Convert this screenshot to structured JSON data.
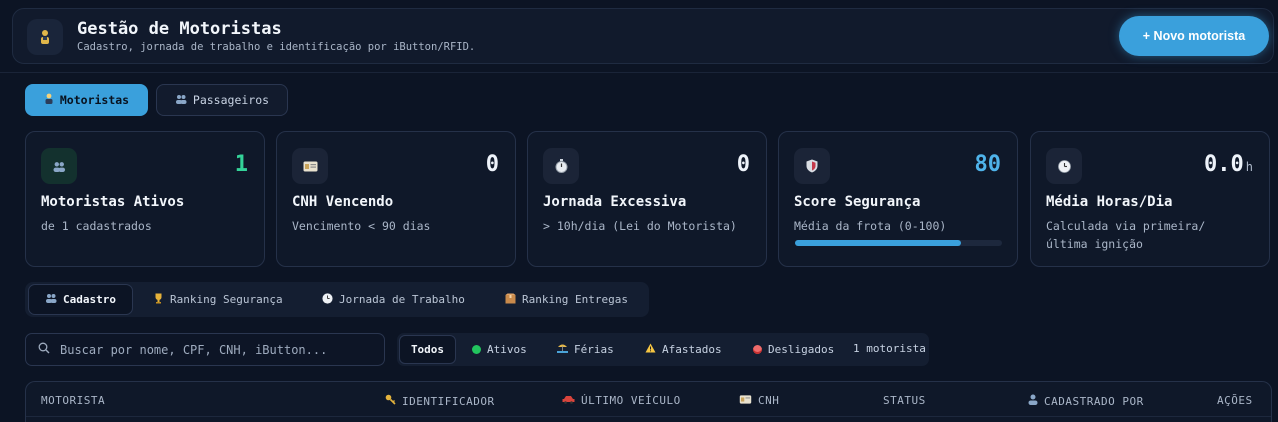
{
  "header": {
    "title": "Gestão de Motoristas",
    "subtitle": "Cadastro, jornada de trabalho e identificação por iButton/RFID.",
    "logo_icon": "driver-icon",
    "new_button": "+ Novo motorista"
  },
  "segments": [
    {
      "label": "Motoristas",
      "icon": "driver-icon",
      "active": true
    },
    {
      "label": "Passageiros",
      "icon": "people-icon",
      "active": false
    }
  ],
  "stats": [
    {
      "icon": "people-icon",
      "value": "1",
      "label": "Motoristas Ativos",
      "desc": "de 1 cadastrados",
      "value_color": "#34d399"
    },
    {
      "icon": "id-card-icon",
      "value": "0",
      "label": "CNH Vencendo",
      "desc": "Vencimento < 90 dias",
      "value_color": "#eef3fa"
    },
    {
      "icon": "stopwatch-icon",
      "value": "0",
      "label": "Jornada Excessiva",
      "desc": "> 10h/dia (Lei do Motorista)",
      "value_color": "#eef3fa"
    },
    {
      "icon": "shield-icon",
      "value": "80",
      "label": "Score Segurança",
      "desc": "Média da frota (0-100)",
      "value_color": "#4fb3ea",
      "progress": 0.8
    },
    {
      "icon": "clock-icon",
      "value": "0.0",
      "unit": "h",
      "label": "Média Horas/Dia",
      "desc": "Calculada via primeira/ última ignição",
      "value_color": "#eef3fa"
    }
  ],
  "subtabs": [
    {
      "label": "Cadastro",
      "icon": "people-icon",
      "active": true
    },
    {
      "label": "Ranking Segurança",
      "icon": "trophy-icon",
      "active": false
    },
    {
      "label": "Jornada de Trabalho",
      "icon": "clock-icon",
      "active": false
    },
    {
      "label": "Ranking Entregas",
      "icon": "package-icon",
      "active": false
    }
  ],
  "search": {
    "placeholder": "Buscar por nome, CPF, CNH, iButton..."
  },
  "filters": [
    {
      "label": "Todos",
      "active": true
    },
    {
      "label": "Ativos",
      "icon": "green-dot-icon",
      "color": "#22c55e"
    },
    {
      "label": "Férias",
      "icon": "beach-icon"
    },
    {
      "label": "Afastados",
      "icon": "warning-icon"
    },
    {
      "label": "Desligados",
      "icon": "red-dot-icon",
      "color": "#ef4444"
    }
  ],
  "count_label": "1 motorista",
  "table": {
    "columns": [
      {
        "label": "MOTORISTA"
      },
      {
        "label": "IDENTIFICADOR",
        "icon": "key-icon"
      },
      {
        "label": "ÚLTIMO VEÍCULO",
        "icon": "car-icon"
      },
      {
        "label": "CNH",
        "icon": "id-card-icon"
      },
      {
        "label": "STATUS"
      },
      {
        "label": "CADASTRADO POR",
        "icon": "user-icon"
      },
      {
        "label": "AÇÕES"
      }
    ]
  }
}
